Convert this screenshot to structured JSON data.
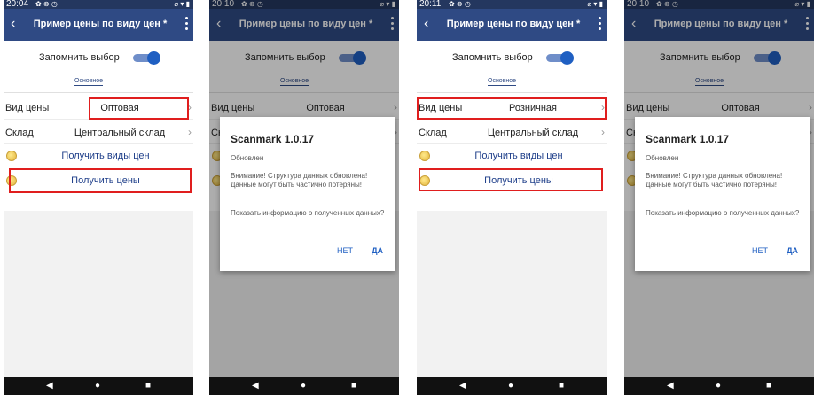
{
  "status_times": [
    "20:04",
    "20:10",
    "20:11",
    "20:10"
  ],
  "status_icons_left": "✿ ⊗ ◷",
  "status_icons_right": "⌀ ▾ ▮",
  "header": {
    "back_icon": "chevron-left-icon",
    "title": "Пример цены по виду цен *",
    "menu_icon": "overflow-menu-icon"
  },
  "remember_label": "Запомнить выбор",
  "tab_label": "Основное",
  "rows": {
    "price_type_label": "Вид цены",
    "warehouse_label": "Склад"
  },
  "price_type_values": [
    "Оптовая",
    "Оптовая",
    "Розничная",
    "Оптовая"
  ],
  "warehouse_value": "Центральный склад",
  "actions": {
    "get_price_types": "Получить виды цен",
    "get_prices": "Получить цены"
  },
  "dialog": {
    "title": "Scanmark 1.0.17",
    "subtitle": "Обновлен",
    "body": "Внимание! Структура данных обновлена! Данные могут быть частично потеряны!",
    "question": "Показать информацию о полученных данных?",
    "no_label": "НЕТ",
    "yes_label": "ДА"
  },
  "nav": {
    "back": "◀",
    "home": "●",
    "recents": "■"
  },
  "colors": {
    "status_bar": "#24375f",
    "app_bar": "#2f4a84",
    "toggle_on": "#1f5fc2",
    "highlight": "#e01e1e",
    "link": "#1f3f8a"
  }
}
